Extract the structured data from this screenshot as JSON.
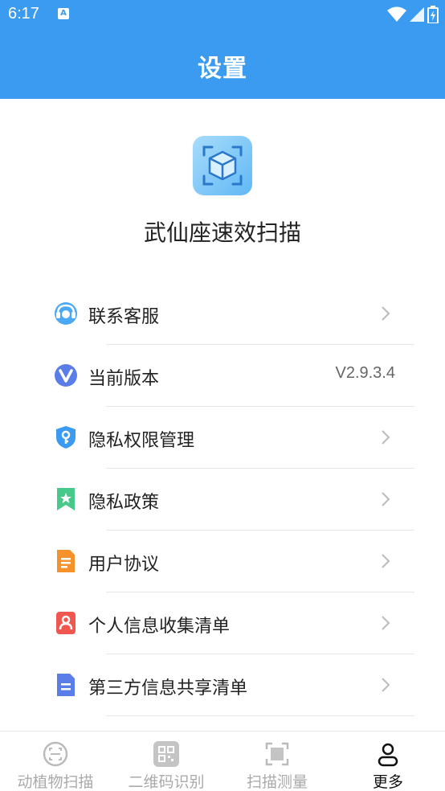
{
  "status_bar": {
    "time": "6:17",
    "sim_badge": "A"
  },
  "header": {
    "title": "设置"
  },
  "app": {
    "name": "武仙座速效扫描",
    "logo_icon": "3d-box-scan-icon"
  },
  "settings": {
    "items": [
      {
        "label": "联系客服",
        "icon": "customer-service-icon",
        "value": "",
        "chevron": true
      },
      {
        "label": "当前版本",
        "icon": "version-icon",
        "value": "V2.9.3.4",
        "chevron": false
      },
      {
        "label": "隐私权限管理",
        "icon": "shield-key-icon",
        "value": "",
        "chevron": true
      },
      {
        "label": "隐私政策",
        "icon": "bookmark-star-icon",
        "value": "",
        "chevron": true
      },
      {
        "label": "用户协议",
        "icon": "document-icon",
        "value": "",
        "chevron": true
      },
      {
        "label": "个人信息收集清单",
        "icon": "person-card-icon",
        "value": "",
        "chevron": true
      },
      {
        "label": "第三方信息共享清单",
        "icon": "list-document-icon",
        "value": "",
        "chevron": true
      }
    ]
  },
  "bottom_nav": {
    "tabs": [
      {
        "label": "动植物扫描",
        "icon": "plant-scan-icon",
        "active": false
      },
      {
        "label": "二维码识别",
        "icon": "qrcode-icon",
        "active": false
      },
      {
        "label": "扫描测量",
        "icon": "measure-scan-icon",
        "active": false
      },
      {
        "label": "更多",
        "icon": "person-icon",
        "active": true
      }
    ]
  },
  "colors": {
    "primary": "#3a9bf0",
    "text": "#222222",
    "muted": "#aaaaaa"
  }
}
